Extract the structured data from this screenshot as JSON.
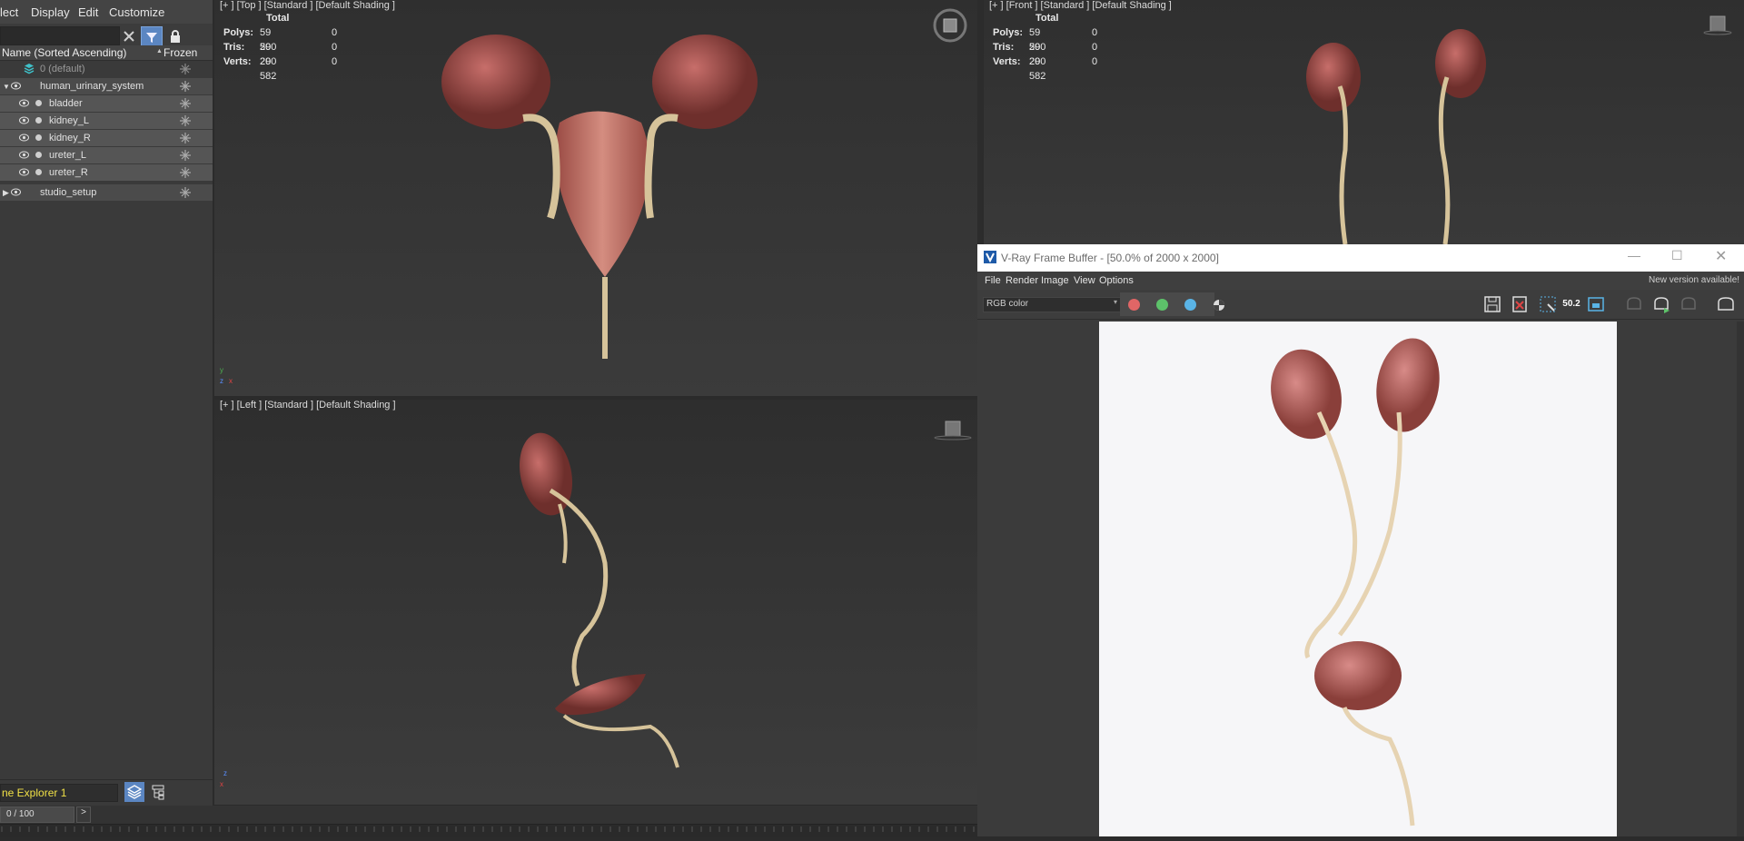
{
  "menu": {
    "select": "lect",
    "display": "Display",
    "edit": "Edit",
    "customize": "Customize"
  },
  "explorer": {
    "col_name": "Name (Sorted Ascending)",
    "col_sort": "▲",
    "col_frozen": "Frozen",
    "rows": [
      {
        "label": "0 (default)"
      },
      {
        "label": "human_urinary_system"
      },
      {
        "label": "bladder"
      },
      {
        "label": "kidney_L"
      },
      {
        "label": "kidney_R"
      },
      {
        "label": "ureter_L"
      },
      {
        "label": "ureter_R"
      },
      {
        "label": "studio_setup"
      }
    ],
    "footer_name": "ne Explorer 1",
    "frame": "0 / 100",
    "next": ">"
  },
  "viewports": {
    "top": {
      "label": "[+ ]  [Top ]   [Standard ]  [Default Shading ]"
    },
    "front": {
      "label": "[+ ]  [Front ]   [Standard ]  [Default Shading ]"
    },
    "left": {
      "label": "[+ ]  [Left ]   [Standard ]  [Default Shading ]"
    },
    "stats": {
      "total": "Total",
      "polys_k": "Polys:",
      "polys_v": "59 200",
      "polys_z": "0",
      "tris_k": "Tris:",
      "tris_v": "59 200",
      "tris_z": "0",
      "verts_k": "Verts:",
      "verts_v": "29 582",
      "verts_z": "0"
    }
  },
  "vfb": {
    "title": "V-Ray Frame Buffer - [50.0% of 2000 x 2000]",
    "menus": [
      "File",
      "Render",
      "Image",
      "View",
      "Options"
    ],
    "new_version": "New version available!",
    "channel": "RGB color",
    "zoom": "50.2",
    "colors": {
      "red": "#e06666",
      "green": "#5dc26a",
      "blue": "#5ab4e6"
    }
  }
}
